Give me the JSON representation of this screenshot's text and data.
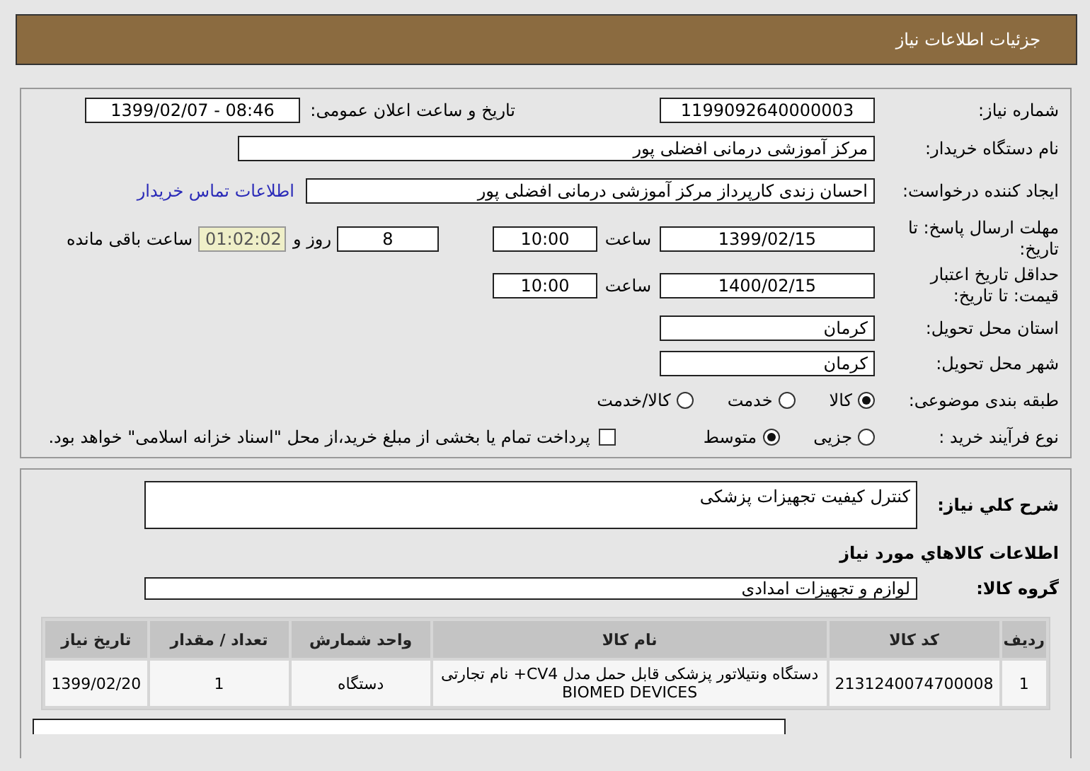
{
  "header": {
    "title": "جزئیات اطلاعات نیاز"
  },
  "details": {
    "need_number": {
      "label": "شماره نیاز:",
      "value": "1199092640000003"
    },
    "announce": {
      "label": "تاریخ و ساعت اعلان عمومی:",
      "value": "1399/02/07 - 08:46"
    },
    "buyer": {
      "label": "نام دستگاه خریدار:",
      "value": "مرکز آموزشی درمانی افضلی پور"
    },
    "requester": {
      "label": "ایجاد کننده درخواست:",
      "value": "احسان زندی  کارپرداز مرکز آموزشی درمانی افضلی پور",
      "link": "اطلاعات تماس خریدار"
    },
    "deadline": {
      "label": "مهلت ارسال پاسخ: تا تاریخ:",
      "date": "1399/02/15",
      "time_label": "ساعت",
      "time": "10:00",
      "days": "8",
      "days_label": "روز و",
      "remaining": "01:02:02",
      "remaining_label": "ساعت باقی مانده"
    },
    "validity": {
      "label": "حداقل تاریخ اعتبار قیمت: تا تاریخ:",
      "date": "1400/02/15",
      "time_label": "ساعت",
      "time": "10:00"
    },
    "province": {
      "label": "استان محل تحویل:",
      "value": "کرمان"
    },
    "city": {
      "label": "شهر محل تحویل:",
      "value": "کرمان"
    },
    "category": {
      "label": "طبقه بندی موضوعی:",
      "options": [
        {
          "label": "کالا",
          "selected": true
        },
        {
          "label": "خدمت",
          "selected": false
        },
        {
          "label": "کالا/خدمت",
          "selected": false
        }
      ]
    },
    "process": {
      "label": "نوع فرآیند خرید :",
      "options": [
        {
          "label": "جزیی",
          "selected": false
        },
        {
          "label": "متوسط",
          "selected": true
        }
      ],
      "payment": {
        "checked": false,
        "text": "پرداخت تمام یا بخشی از مبلغ خرید،از محل \"اسناد خزانه اسلامی\" خواهد بود."
      }
    }
  },
  "goods": {
    "description": {
      "label": "شرح کلي نياز:",
      "value": "کنترل کيفيت تجهيزات پزشکی"
    },
    "section_title": "اطلاعات كالاهاي مورد نياز",
    "group": {
      "label": "گروه کالا:",
      "value": "لوازم و تجهیزات امدادی"
    },
    "table": {
      "columns": [
        "ردیف",
        "کد کالا",
        "نام کالا",
        "واحد شمارش",
        "تعداد / مقدار",
        "تاریخ نیاز"
      ],
      "rows": [
        [
          "1",
          "2131240074700008",
          "دستگاه ونتیلاتور پزشکی قابل حمل مدل CV4+ نام تجارتی BIOMED DEVICES",
          "دستگاه",
          "1",
          "1399/02/20"
        ]
      ]
    }
  }
}
